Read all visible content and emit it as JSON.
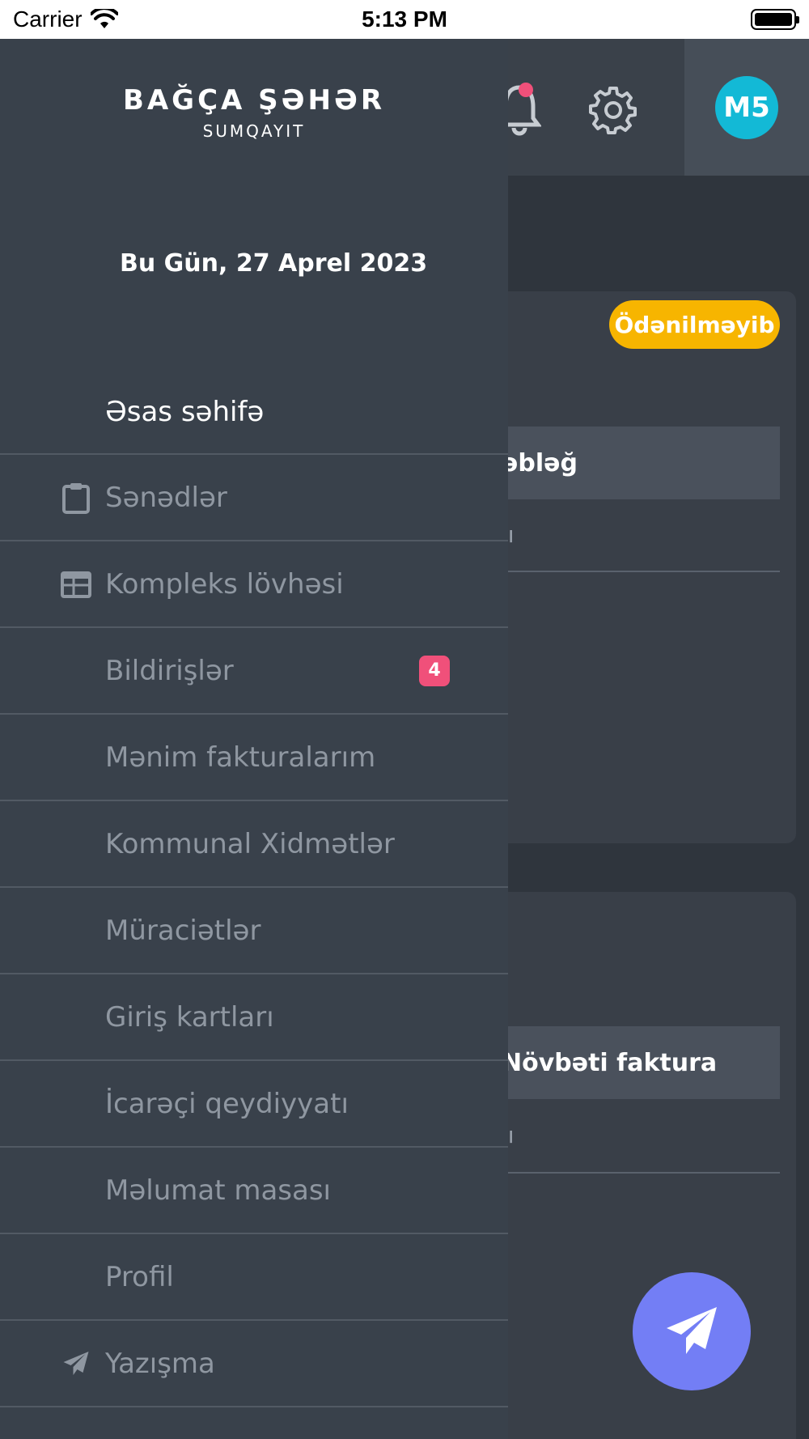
{
  "status_bar": {
    "carrier": "Carrier",
    "time": "5:13 PM"
  },
  "header": {
    "avatar_initials": "M5",
    "notification_dot_color": "#f0507a",
    "avatar_color": "#13b9d6"
  },
  "background": {
    "status_badge": "Ödənilməyib",
    "row1_heading_fragment": "əbləğ",
    "row1_subtext_fragment": "lı",
    "row2_heading_fragment": "Növbəti faktura",
    "row2_subtext_fragment": "lı",
    "fab_color": "#737ef5"
  },
  "drawer": {
    "logo_title": "BAĞÇA ŞƏHƏR",
    "logo_subtitle": "SUMQAYIT",
    "date_text": "Bu Gün, 27 Aprel 2023",
    "menu": [
      {
        "label": "Əsas səhifə",
        "icon": "",
        "active": true
      },
      {
        "label": "Sənədlər",
        "icon": "clipboard-icon"
      },
      {
        "label": "Kompleks lövhəsi",
        "icon": "calendar-table-icon"
      },
      {
        "label": "Bildirişlər",
        "icon": "",
        "badge": "4"
      },
      {
        "label": "Mənim fakturalarım",
        "icon": ""
      },
      {
        "label": "Kommunal Xidmətlər",
        "icon": ""
      },
      {
        "label": "Müraciətlər",
        "icon": ""
      },
      {
        "label": "Giriş kartları",
        "icon": ""
      },
      {
        "label": "İcarəçi qeydiyyatı",
        "icon": ""
      },
      {
        "label": "Məlumat masası",
        "icon": ""
      },
      {
        "label": "Profil",
        "icon": ""
      },
      {
        "label": "Yazışma",
        "icon": "paper-plane-icon"
      }
    ]
  }
}
